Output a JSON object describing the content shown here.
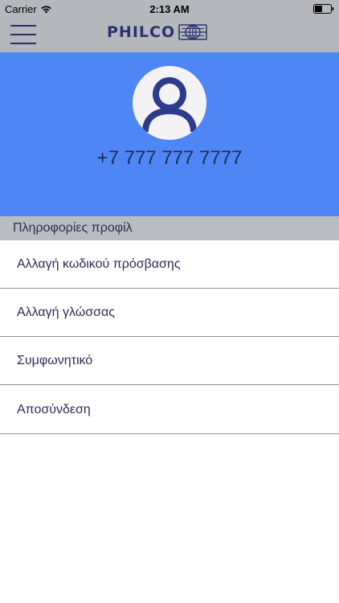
{
  "status_bar": {
    "carrier": "Carrier",
    "time": "2:13 AM"
  },
  "header": {
    "logo_text": "PHILCO",
    "menu_icon": "hamburger-menu-icon",
    "logo_icon": "globe-icon"
  },
  "profile": {
    "avatar_icon": "user-avatar-icon",
    "phone": "+7 777 777 7777"
  },
  "section": {
    "title": "Πληροφορίες προφίλ"
  },
  "menu": {
    "items": [
      {
        "label": "Αλλαγή κωδικού πρόσβασης"
      },
      {
        "label": "Αλλαγή γλώσσας"
      },
      {
        "label": "Συμφωνητικό"
      },
      {
        "label": "Αποσύνδεση"
      }
    ]
  },
  "colors": {
    "top_bar": "#b4b7bb",
    "profile_background": "#4f86f5",
    "section_header": "#b9bcc0",
    "text": "#2b2d55",
    "logo": "#2a3173",
    "avatar_icon": "#2e3a8a"
  }
}
